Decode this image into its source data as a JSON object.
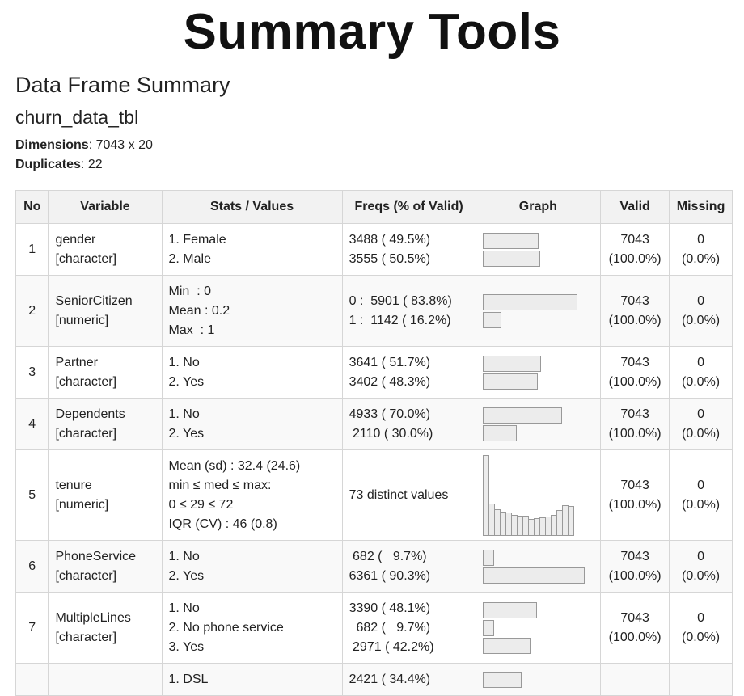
{
  "page_title": "Summary Tools",
  "section_title": "Data Frame Summary",
  "object_name": "churn_data_tbl",
  "dimensions": {
    "label": "Dimensions",
    "value": ": 7043 x 20"
  },
  "duplicates": {
    "label": "Duplicates",
    "value": ": 22"
  },
  "columns": [
    "No",
    "Variable",
    "Stats / Values",
    "Freqs (% of Valid)",
    "Graph",
    "Valid",
    "Missing"
  ],
  "rows": [
    {
      "no": "1",
      "var": "gender",
      "type": "[character]",
      "stats": [
        "1. Female",
        "2. Male"
      ],
      "freqs": [
        "3488 ( 49.5%)",
        "3555 ( 50.5%)"
      ],
      "bars": [
        0.495,
        0.505
      ],
      "valid": "7043",
      "valid_pct": "(100.0%)",
      "missing": "0",
      "missing_pct": "(0.0%)"
    },
    {
      "no": "2",
      "var": "SeniorCitizen",
      "type": "[numeric]",
      "stats": [
        "Min  : 0",
        "Mean : 0.2",
        "Max  : 1"
      ],
      "freqs": [
        "0 :  5901 ( 83.8%)",
        "1 :  1142 ( 16.2%)"
      ],
      "bars": [
        0.838,
        0.162
      ],
      "valid": "7043",
      "valid_pct": "(100.0%)",
      "missing": "0",
      "missing_pct": "(0.0%)"
    },
    {
      "no": "3",
      "var": "Partner",
      "type": "[character]",
      "stats": [
        "1. No",
        "2. Yes"
      ],
      "freqs": [
        "3641 ( 51.7%)",
        "3402 ( 48.3%)"
      ],
      "bars": [
        0.517,
        0.483
      ],
      "valid": "7043",
      "valid_pct": "(100.0%)",
      "missing": "0",
      "missing_pct": "(0.0%)"
    },
    {
      "no": "4",
      "var": "Dependents",
      "type": "[character]",
      "stats": [
        "1. No",
        "2. Yes"
      ],
      "freqs": [
        "4933 ( 70.0%)",
        " 2110 ( 30.0%)"
      ],
      "bars": [
        0.7,
        0.3
      ],
      "valid": "7043",
      "valid_pct": "(100.0%)",
      "missing": "0",
      "missing_pct": "(0.0%)"
    },
    {
      "no": "5",
      "var": "tenure",
      "type": "[numeric]",
      "stats": [
        "Mean (sd) : 32.4 (24.6)",
        "min ≤ med ≤ max:",
        "0 ≤ 29 ≤ 72",
        "IQR (CV) : 46 (0.8)"
      ],
      "freqs": [
        "73 distinct values"
      ],
      "hist": [
        1.0,
        0.4,
        0.33,
        0.3,
        0.29,
        0.26,
        0.25,
        0.25,
        0.21,
        0.22,
        0.23,
        0.24,
        0.26,
        0.32,
        0.38,
        0.37
      ],
      "valid": "7043",
      "valid_pct": "(100.0%)",
      "missing": "0",
      "missing_pct": "(0.0%)"
    },
    {
      "no": "6",
      "var": "PhoneService",
      "type": "[character]",
      "stats": [
        "1. No",
        "2. Yes"
      ],
      "freqs": [
        " 682 (   9.7%)",
        "6361 ( 90.3%)"
      ],
      "bars": [
        0.097,
        0.903
      ],
      "valid": "7043",
      "valid_pct": "(100.0%)",
      "missing": "0",
      "missing_pct": "(0.0%)"
    },
    {
      "no": "7",
      "var": "MultipleLines",
      "type": "[character]",
      "stats": [
        "1. No",
        "2. No phone service",
        "3. Yes"
      ],
      "freqs": [
        "3390 ( 48.1%)",
        "  682 (   9.7%)",
        " 2971 ( 42.2%)"
      ],
      "bars": [
        0.481,
        0.097,
        0.422
      ],
      "valid": "7043",
      "valid_pct": "(100.0%)",
      "missing": "0",
      "missing_pct": "(0.0%)"
    },
    {
      "no": "",
      "var": "",
      "type": "",
      "stats": [
        "1. DSL"
      ],
      "freqs": [
        "2421 ( 34.4%)"
      ],
      "bars": [
        0.344
      ],
      "valid": "",
      "valid_pct": "",
      "missing": "",
      "missing_pct": ""
    }
  ]
}
